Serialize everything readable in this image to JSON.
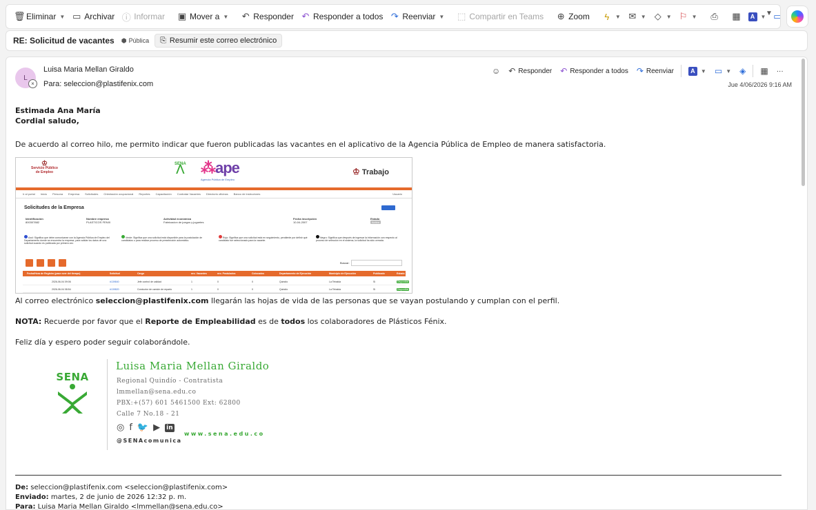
{
  "toolbar": {
    "eliminar": "Eliminar",
    "archivar": "Archivar",
    "informar": "Informar",
    "mover": "Mover a",
    "responder": "Responder",
    "responder_todos": "Responder a todos",
    "reenviar": "Reenviar",
    "teams": "Compartir en Teams",
    "zoom": "Zoom",
    "more": "···"
  },
  "subject": {
    "title": "RE: Solicitud de vacantes",
    "visibility": "Pública",
    "summarize": "Resumir este correo electrónico"
  },
  "message": {
    "avatar_initial": "L",
    "sender": "Luisa Maria Mellan Giraldo",
    "to_label": "Para:",
    "to": "seleccion@plastifenix.com",
    "date": "Jue 4/06/2026 9:16 AM",
    "actions": {
      "responder": "Responder",
      "responder_todos": "Responder a todos",
      "reenviar": "Reenviar",
      "more": "···"
    }
  },
  "body": {
    "greeting1": "Estimada Ana María",
    "greeting2": "Cordial saludo,",
    "intro": "De acuerdo al correo hilo, me permito indicar que fueron publicadas las vacantes en el aplicativo de la Agencia Pública de Empleo de manera satisfactoria.",
    "cv_pre": "Al correo electrónico ",
    "cv_email": "seleccion@plastifenix.com",
    "cv_post": " llegarán las hojas de vida de las personas que se vayan postulando y cumplan con el perfil.",
    "nota_label": "NOTA:",
    "nota_1": " Recuerde por favor que el ",
    "nota_bold1": "Reporte de Empleabilidad",
    "nota_2": " es de ",
    "nota_bold2": "todos",
    "nota_3": " los colaboradores de Plásticos Fénix.",
    "closing": "Feliz día y espero poder seguir colaborándole."
  },
  "screenshot": {
    "sp_logo_line1": "Servicio Público",
    "sp_logo_line2": "de Empleo",
    "sena": "SENA",
    "ape": "ape",
    "ape_sub": "Agencia Pública de Empleo",
    "trabajo": "Trabajo",
    "nav": [
      "Ir al portal",
      "Inicio",
      "Persona",
      "Empresa",
      "Solicitudes",
      "Orientación ocupacional",
      "Reportes",
      "Capacitación",
      "Contratar Vacantes",
      "Directorio oficinas",
      "Banco de instructores"
    ],
    "nav_user": "Usuario",
    "title": "Solicitudes de la Empresa",
    "info_headers": [
      "Identificación",
      "Nombre empresa",
      "Actividad económica",
      "Fecha inscripción",
      "Estado"
    ],
    "info_values": [
      "800307882",
      "PLASTICOS FENIX",
      "Fabricacion de juegos y juguetes",
      "10-04-2007",
      "Activa"
    ],
    "legend": [
      {
        "color": "#2f4fd0",
        "text": "Azul: Significa que debe comunicarse con la Agencia Pública de Empleo del Departamento donde se encuentra la empresa, para validar los datos de una solicitud cuando es publicada por primera vez."
      },
      {
        "color": "#39a935",
        "text": "Verde: Significa que una solicitud está disponible para la postulación de candidatos o para realizar proceso de preselección automático."
      },
      {
        "color": "#e03b3b",
        "text": "Rojo: Significa que una solicitud está en seguimiento, pendiente por definir qué candidato fue seleccionado para la vacante."
      },
      {
        "color": "#111111",
        "text": "Negro: Significa que después de ingresar la información con respecto al proceso de selección en el sistema, la solicitud ha sido cerrada."
      }
    ],
    "buscar": "Buscar:",
    "table_headers": [
      "Fecha/Hora de Registro (pase over del tiempo)",
      "Solicitud",
      "Cargo",
      "nro. Vacantes",
      "nro. Postulados",
      "Colocados",
      "Departamento de Ejecución",
      "Municipio de Ejecución",
      "Publicado",
      "Estado"
    ],
    "rows": [
      [
        "2026-06-04 09:06",
        "#139840",
        "Jefe control de calidad",
        "1",
        "0",
        "0",
        "Quindío",
        "La Tebaida",
        "Si",
        "Disponible"
      ],
      [
        "2026-06-04 08:54",
        "#139820",
        "Conductor de camión de reparto",
        "1",
        "0",
        "0",
        "Quindío",
        "La Tebaida",
        "Si",
        "Disponible"
      ]
    ]
  },
  "signature": {
    "logo_text": "SENA",
    "name": "Luisa Maria Mellan Giraldo",
    "line1": "Regional Quindío - Contratista",
    "line2": "lmmellan@sena.edu.co",
    "line3": "PBX:+(57) 601 5461500 Ext: 62800",
    "line4": "Calle 7 No.18 - 21",
    "web": "www.sena.edu.co",
    "handle": "@SENAcomunica",
    "linkedin": "in"
  },
  "headers": {
    "de_label": "De:",
    "de": " seleccion@plastifenix.com <seleccion@plastifenix.com>",
    "enviado_label": "Enviado:",
    "enviado": " martes, 2 de junio de 2026 12:32 p. m.",
    "para_label": "Para:",
    "para": " Luisa Maria Mellan Giraldo <lmmellan@sena.edu.co>"
  }
}
